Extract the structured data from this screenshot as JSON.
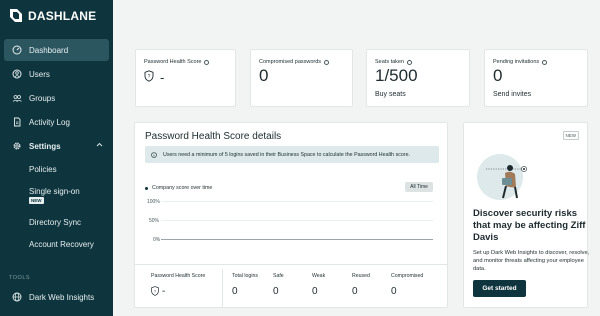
{
  "app": {
    "name": "DASHLANE"
  },
  "sidebar": {
    "items": [
      {
        "label": "Dashboard",
        "icon": "dashboard-gauge-icon",
        "active": true
      },
      {
        "label": "Users",
        "icon": "user-circle-icon"
      },
      {
        "label": "Groups",
        "icon": "groups-icon"
      },
      {
        "label": "Activity Log",
        "icon": "document-icon"
      },
      {
        "label": "Settings",
        "icon": "gear-icon",
        "expanded": true
      }
    ],
    "settings_sub": [
      {
        "label": "Policies"
      },
      {
        "label": "Single sign-on",
        "badge": "NEW"
      },
      {
        "label": "Directory Sync"
      },
      {
        "label": "Account Recovery"
      }
    ],
    "tools_label": "TOOLS",
    "tools": [
      {
        "label": "Dark Web Insights",
        "icon": "dark-web-globe-icon"
      }
    ]
  },
  "stats": [
    {
      "label": "Password Health Score",
      "value": "-",
      "link": ""
    },
    {
      "label": "Compromised passwords",
      "value": "0",
      "link": ""
    },
    {
      "label": "Seats taken",
      "value": "1/500",
      "link": "Buy seats"
    },
    {
      "label": "Pending invitations",
      "value": "0",
      "link": "Send invites"
    }
  ],
  "details": {
    "title": "Password Health Score details",
    "notice": "Users need a minimum of 5 logins saved in their Business Space to calculate the Password Health score.",
    "legend": "Company score over time",
    "range_button": "All Time",
    "ticks": [
      "100%",
      "50%",
      "0%"
    ],
    "metrics": [
      {
        "label": "Password Health Score",
        "value": "-"
      },
      {
        "label": "Total logins",
        "value": "0"
      },
      {
        "label": "Safe",
        "value": "0"
      },
      {
        "label": "Weak",
        "value": "0"
      },
      {
        "label": "Reused",
        "value": "0"
      },
      {
        "label": "Compromised",
        "value": "0"
      }
    ]
  },
  "promo": {
    "tag": "NEW",
    "title": "Discover security risks that may be affecting Ziff Davis",
    "text": "Set up Dark Web Insights to discover, resolve, and monitor threats affecting your employee data.",
    "button": "Get started"
  },
  "colors": {
    "sidebar_bg": "#0e353d",
    "active_item": "#2b5660",
    "notice_bg": "#dde9ea",
    "primary_button": "#0e353d"
  }
}
